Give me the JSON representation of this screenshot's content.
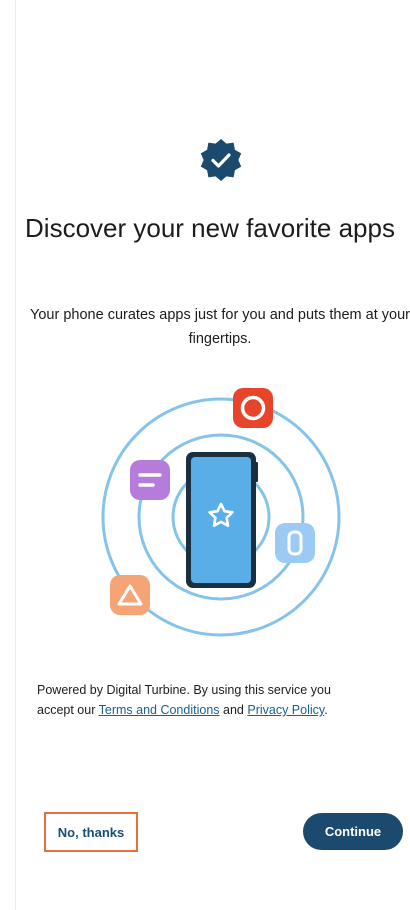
{
  "onboarding": {
    "title": "Discover your new favorite apps",
    "subtitle": "Your phone curates apps just for you and puts them at your fingertips.",
    "legal": {
      "prefix": "Powered by Digital Turbine. By using this service you accept our",
      "terms_link": "Terms and Conditions",
      "conjunction": "and",
      "privacy_link": "Privacy Policy",
      "suffix": "."
    },
    "buttons": {
      "no_thanks": "No, thanks",
      "continue": "Continue"
    }
  },
  "colors": {
    "primary": "#1c4a6e",
    "link": "#1a5f8f",
    "highlight_border": "#e5703a",
    "orbit": "#86c3ea",
    "phone_screen": "#5aaee8",
    "icon_red": "#e8432b",
    "icon_purple": "#b57cdc",
    "icon_blue": "#9bcaf5",
    "icon_orange": "#f4a475"
  },
  "icons": {
    "badge": "verified-check-badge-icon",
    "star": "star-icon",
    "red_app": "circle-app-icon",
    "purple_app": "lines-app-icon",
    "blue_app": "pill-app-icon",
    "orange_app": "triangle-app-icon"
  }
}
